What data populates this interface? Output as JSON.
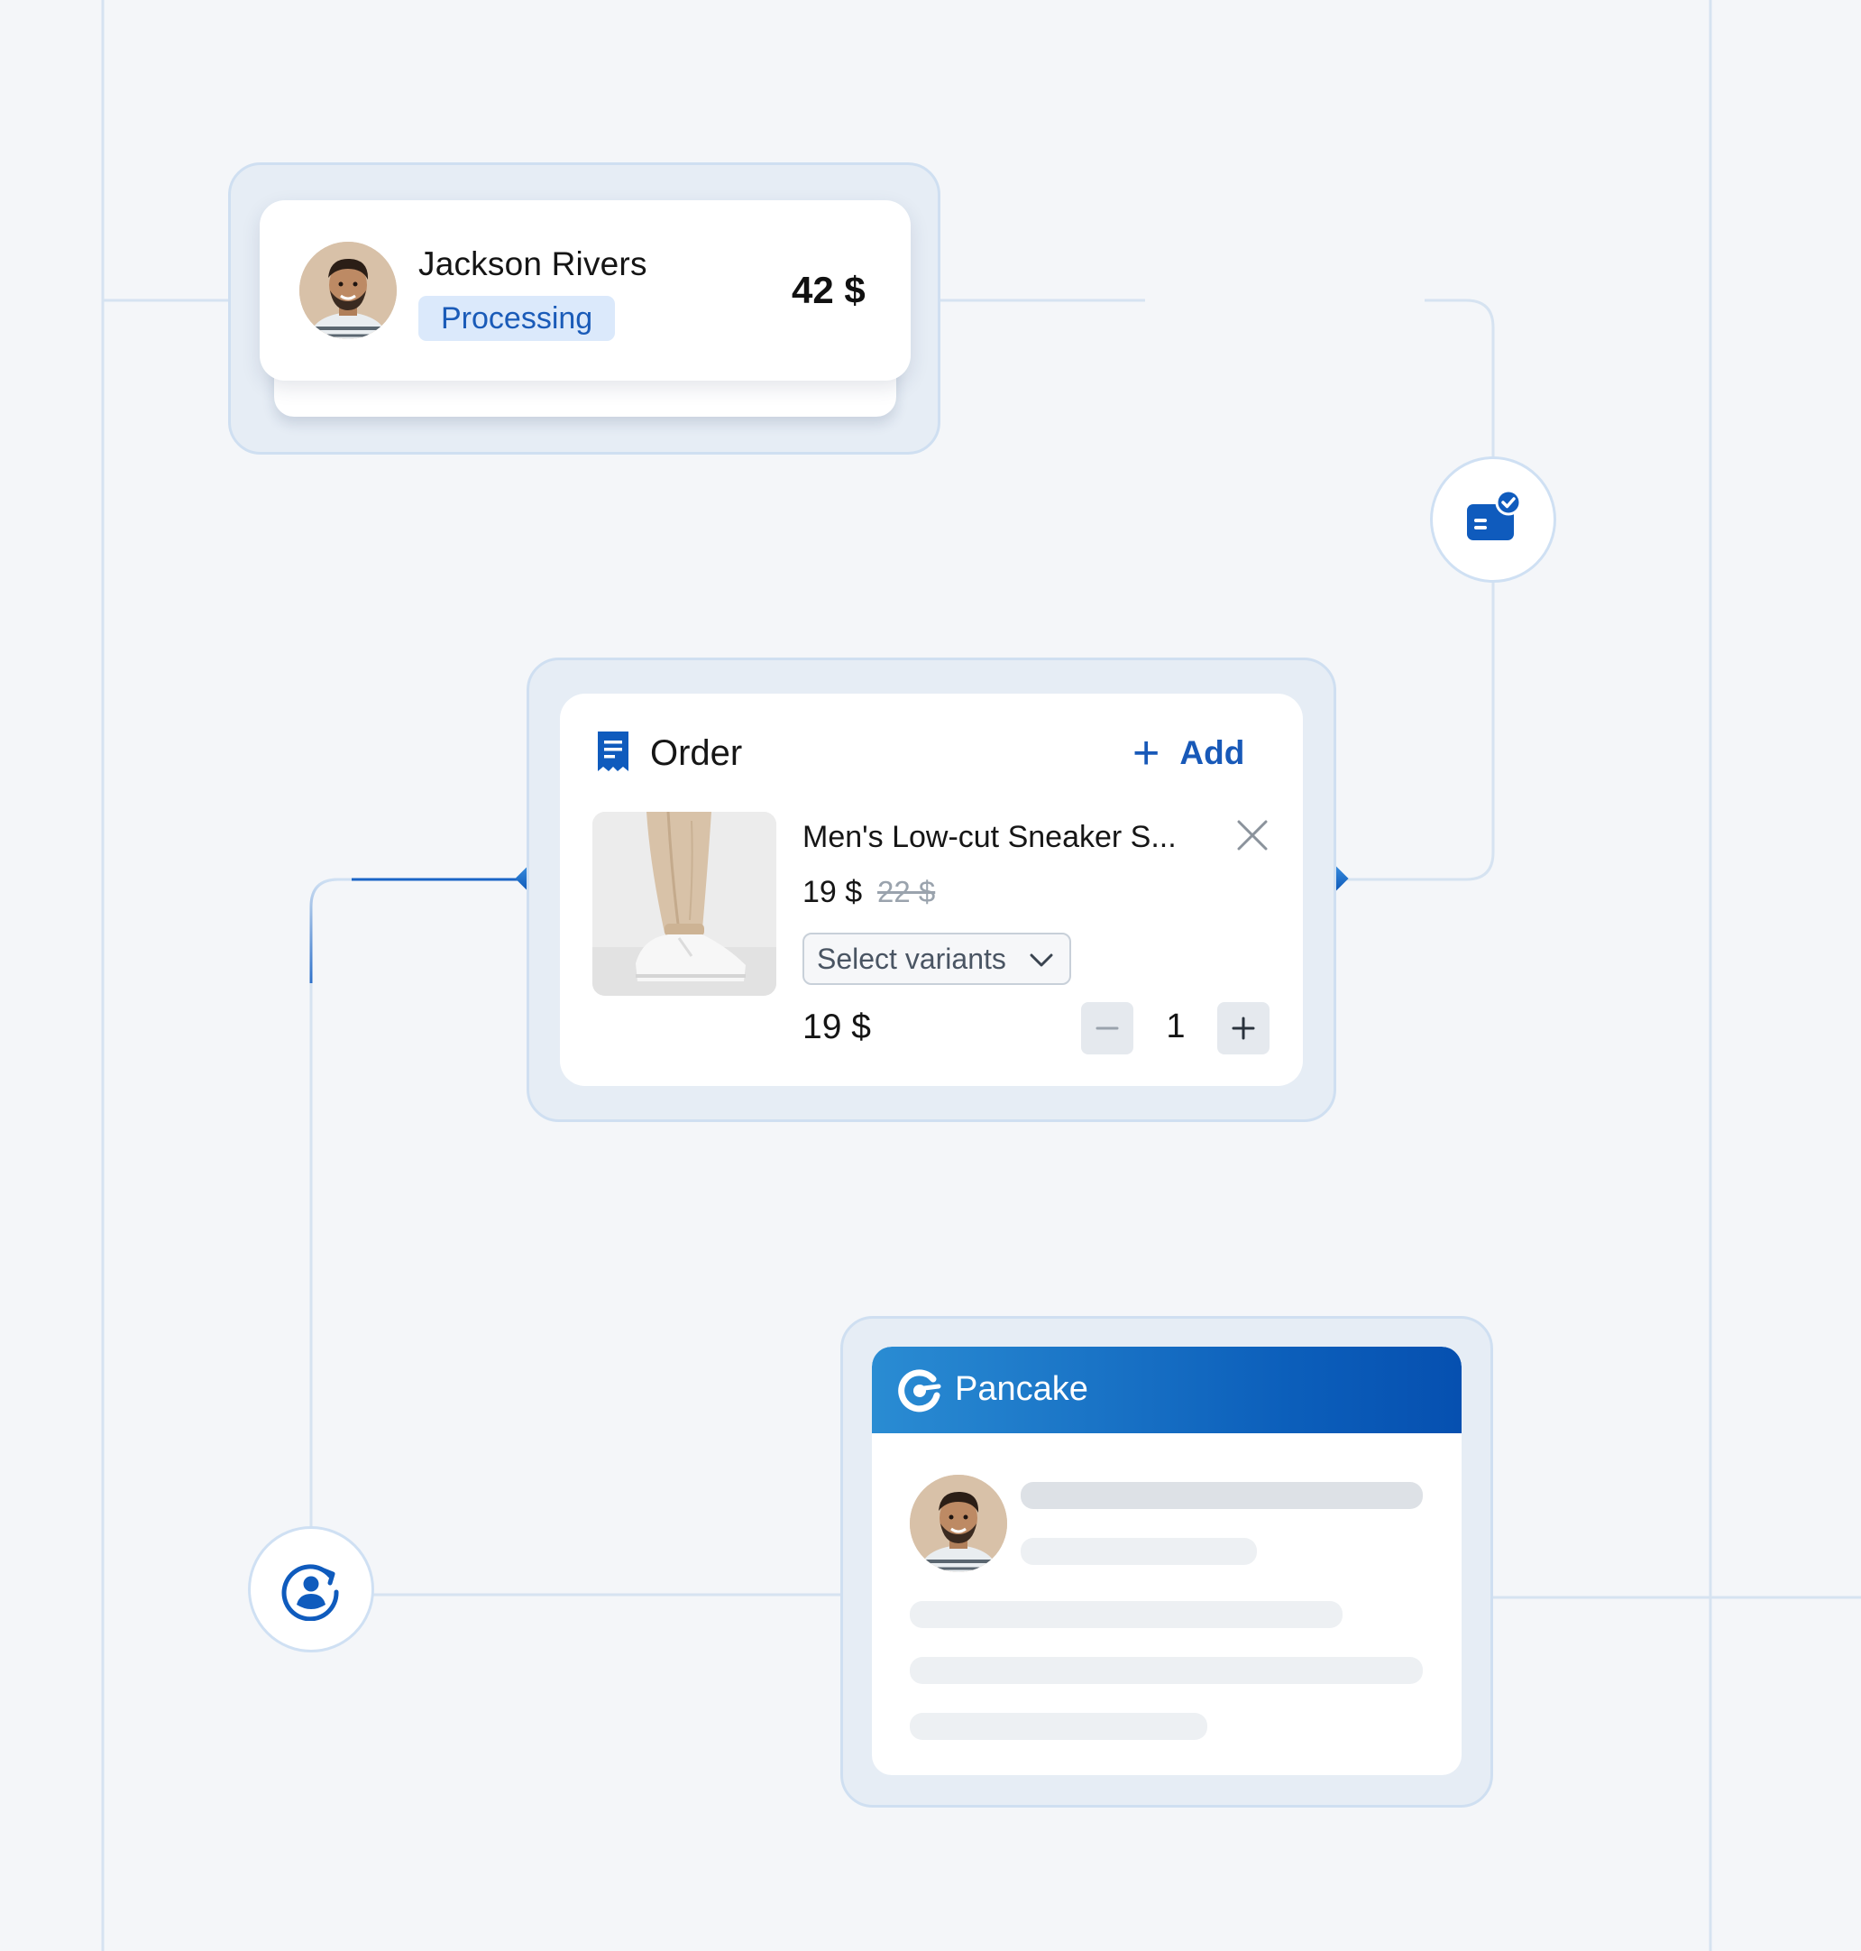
{
  "customer": {
    "name": "Jackson Rivers",
    "status": "Processing",
    "amount": "42 $"
  },
  "order": {
    "title": "Order",
    "add_label": "Add",
    "item": {
      "name": "Men's Low-cut Sneaker S...",
      "price": "19 $",
      "original_price": "22 $",
      "variant_placeholder": "Select variants",
      "line_total": "19 $",
      "quantity": "1"
    }
  },
  "pancake": {
    "title": "Pancake"
  },
  "icons": {
    "payment_node": "payment-check-icon",
    "customer_sync_node": "user-sync-icon",
    "receipt": "receipt-icon",
    "brand": "pancake-logo-icon",
    "close": "close-icon",
    "chevron": "chevron-down-icon",
    "minus": "minus-icon",
    "plus": "plus-icon"
  },
  "colors": {
    "accent": "#1859b8",
    "badge_bg": "#dbe9fb",
    "frame": "#e6edf5",
    "background": "#f4f6f9"
  }
}
